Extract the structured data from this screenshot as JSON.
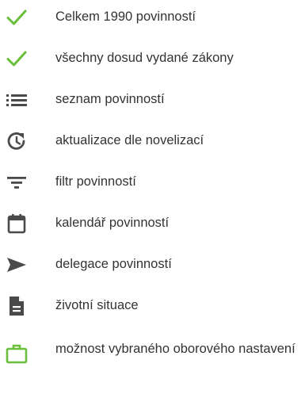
{
  "colors": {
    "accent_green": "#6abf3a",
    "icon_dark": "#4a4a4a",
    "text": "#333333"
  },
  "features": [
    {
      "label": "Celkem 1990 povinností",
      "icon": "check-icon"
    },
    {
      "label": "všechny dosud vydané zákony",
      "icon": "check-icon"
    },
    {
      "label": "seznam povinností",
      "icon": "list-icon"
    },
    {
      "label": "aktualizace dle novelizací",
      "icon": "update-icon"
    },
    {
      "label": "filtr povinností",
      "icon": "filter-icon"
    },
    {
      "label": "kalendář povinností",
      "icon": "calendar-icon"
    },
    {
      "label": "delegace povinností",
      "icon": "send-icon"
    },
    {
      "label": "životní situace",
      "icon": "document-icon"
    },
    {
      "label": "možnost vybraného oborového nastavení",
      "icon": "briefcase-icon"
    }
  ]
}
